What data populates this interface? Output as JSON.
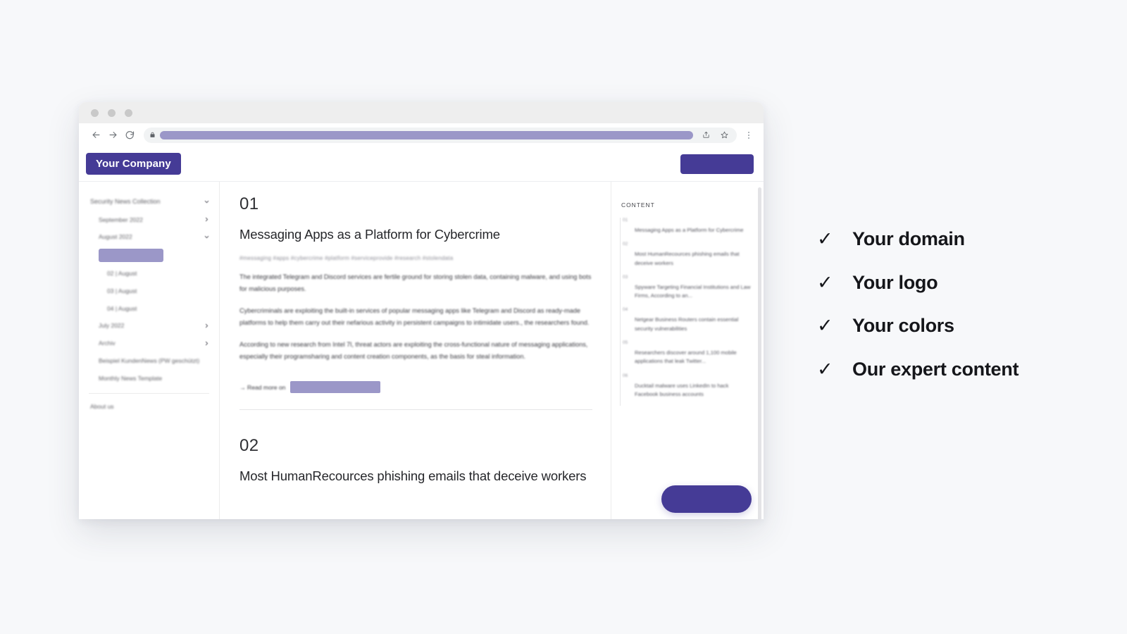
{
  "browser": {
    "back_icon": "arrow-left-icon",
    "forward_icon": "arrow-right-icon",
    "reload_icon": "reload-icon",
    "lock_icon": "lock-icon",
    "url_value": "",
    "url_redacted": true,
    "share_icon": "share-icon",
    "bookmark_icon": "star-icon",
    "menu_icon": "kebab-menu-icon",
    "traffic_lights": [
      "close-dot",
      "minimize-dot",
      "maximize-dot"
    ]
  },
  "app_header": {
    "logo_label": "Your Company",
    "cta_redacted": true
  },
  "sidebar": {
    "items": [
      {
        "label": "Security News Collection",
        "level": 0,
        "chevron": "chevron-down-icon"
      },
      {
        "label": "September 2022",
        "level": 1,
        "chevron": "chevron-right-icon"
      },
      {
        "label": "August 2022",
        "level": 1,
        "chevron": "chevron-down-icon"
      },
      {
        "label": "02 | August",
        "level": 2,
        "chevron": ""
      },
      {
        "label": "03 | August",
        "level": 2,
        "chevron": ""
      },
      {
        "label": "04 | August",
        "level": 2,
        "chevron": ""
      },
      {
        "label": "July 2022",
        "level": 1,
        "chevron": "chevron-right-icon"
      },
      {
        "label": "Archiv",
        "level": 1,
        "chevron": "chevron-right-icon"
      },
      {
        "label": "Beispiel KundenNews (PW geschützt)",
        "level": 1,
        "chevron": ""
      },
      {
        "label": "Monthly News Template",
        "level": 1,
        "chevron": ""
      }
    ],
    "footer_item": "About us",
    "active_item_redacted": true
  },
  "article_01": {
    "index": "01",
    "title": "Messaging Apps as a Platform for Cybercrime",
    "tags": "#messaging #apps #cybercrime #platform #serviceprovide #research #stolendata",
    "paragraphs": [
      "The integrated Telegram and Discord services are fertile ground for storing stolen data, containing malware, and using bots for malicious purposes.",
      "Cybercriminals are exploiting the built-in services of popular messaging apps like Telegram and Discord as ready-made platforms to help them carry out their nefarious activity in persistent campaigns to intimidate users., the researchers found.",
      "According to new research from Intel 7l, threat actors are exploiting the cross-functional nature of messaging applications, especially their programsharing and content creation components, as the basis for steal information."
    ],
    "read_more_label": "→ Read more on",
    "read_more_redacted": true
  },
  "article_02": {
    "index": "02",
    "title": "Most HumanRecources phishing emails that deceive workers"
  },
  "toc": {
    "heading": "CONTENT",
    "entries": [
      {
        "num": "01",
        "text": "Messaging Apps as a Platform for Cybercrime"
      },
      {
        "num": "02",
        "text": "Most HumanRecources phishing emails that deceive workers"
      },
      {
        "num": "03",
        "text": "Spyware Targeting Financial Institutions and Law Firms, According to an..."
      },
      {
        "num": "04",
        "text": "Netgear Business Routers contain essential security vulnerabilities"
      },
      {
        "num": "05",
        "text": "Researchers discover around 1,100 mobile applications that leak Twitter..."
      },
      {
        "num": "06",
        "text": "Ducktail malware uses LinkedIn to hack Facebook business accounts"
      }
    ]
  },
  "fab": {
    "redacted": true
  },
  "checklist": {
    "check_glyph": "✓",
    "items": [
      "Your domain",
      "Your logo",
      "Your colors",
      "Our expert content"
    ]
  },
  "colors": {
    "brand_purple": "#453b96",
    "redaction_light_purple": "#9b97c8",
    "page_background": "#f7f8fa",
    "text_dark": "#15161a"
  }
}
